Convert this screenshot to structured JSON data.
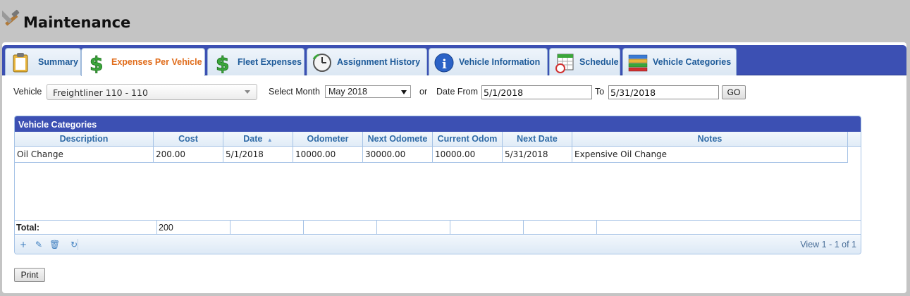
{
  "page": {
    "title": "Maintenance"
  },
  "tabs": [
    {
      "label": "Summary",
      "icon": "clipboard-icon",
      "active": false
    },
    {
      "label": "Expenses Per Vehicle",
      "icon": "dollar-icon",
      "active": true
    },
    {
      "label": "Fleet Expenses",
      "icon": "dollar-icon",
      "active": false
    },
    {
      "label": "Assignment History",
      "icon": "clock-icon",
      "active": false
    },
    {
      "label": "Vehicle Information",
      "icon": "info-icon",
      "active": false
    },
    {
      "label": "Schedule",
      "icon": "calendar-icon",
      "active": false
    },
    {
      "label": "Vehicle Categories",
      "icon": "categories-icon",
      "active": false
    }
  ],
  "filters": {
    "vehicle_label": "Vehicle",
    "vehicle_value": "Freightliner 110 - 110",
    "month_label": "Select Month",
    "month_value": "May 2018",
    "or_label": "or",
    "date_from_label": "Date From",
    "date_from_value": "5/1/2018",
    "to_label": "To",
    "date_to_value": "5/31/2018",
    "go_label": "GO"
  },
  "grid": {
    "caption": "Vehicle Categories",
    "columns": [
      "Description",
      "Cost",
      "Date",
      "Odometer",
      "Next Odomete",
      "Current Odom",
      "Next Date",
      "Notes"
    ],
    "sort_indicator": "▲",
    "rows": [
      [
        "Oil Change",
        "200.00",
        "5/1/2018",
        "10000.00",
        "30000.00",
        "10000.00",
        "5/31/2018",
        "Expensive Oil Change"
      ]
    ],
    "footer": {
      "label": "Total:",
      "total": "200"
    },
    "pager_info": "View 1 - 1 of 1"
  },
  "print_label": "Print",
  "colors": {
    "accent": "#3c50b3",
    "active_tab_text": "#e06c1b",
    "tab_text": "#1d5a99",
    "header_text": "#2e6aa6"
  }
}
